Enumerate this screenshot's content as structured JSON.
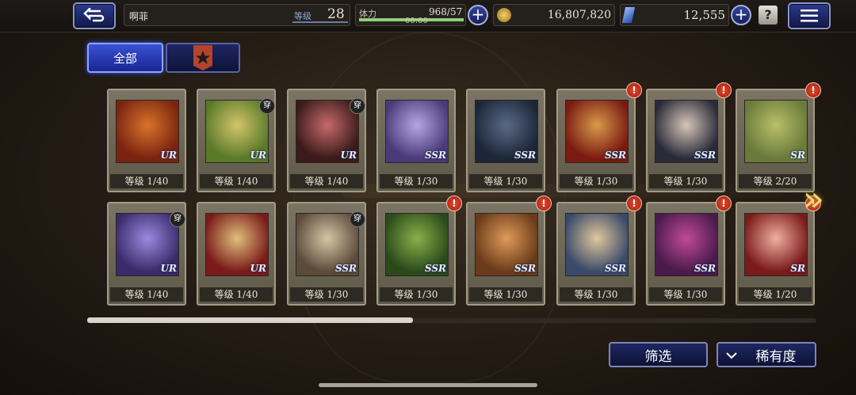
{
  "header": {
    "player_name": "啊菲",
    "level_label": "等级",
    "level_value": "28",
    "stamina_label": "体力",
    "stamina_value": "968/57",
    "stamina_timer": "00:00",
    "gold_value": "16,807,820",
    "gem_value": "12,555",
    "help_label": "?"
  },
  "tabs": {
    "all_label": "全部"
  },
  "cards": [
    {
      "level": "等级 1/40",
      "rarity": "UR",
      "badge": false,
      "alert": false,
      "colors": [
        "#7a2410",
        "#d9732a"
      ]
    },
    {
      "level": "等级 1/40",
      "rarity": "UR",
      "badge": true,
      "alert": false,
      "colors": [
        "#5a7a2a",
        "#d4c46a"
      ]
    },
    {
      "level": "等级 1/40",
      "rarity": "UR",
      "badge": true,
      "alert": false,
      "colors": [
        "#3a1a1a",
        "#c86a6a"
      ]
    },
    {
      "level": "等级 1/30",
      "rarity": "SSR",
      "badge": false,
      "alert": false,
      "colors": [
        "#4a3a7a",
        "#b6a6e0"
      ]
    },
    {
      "level": "等级 1/30",
      "rarity": "SSR",
      "badge": false,
      "alert": false,
      "colors": [
        "#1c2638",
        "#5a6a86"
      ]
    },
    {
      "level": "等级 1/30",
      "rarity": "SSR",
      "badge": false,
      "alert": true,
      "colors": [
        "#7a1a12",
        "#d89a4a"
      ]
    },
    {
      "level": "等级 1/30",
      "rarity": "SSR",
      "badge": false,
      "alert": true,
      "colors": [
        "#2a2a3a",
        "#d6c6b6"
      ]
    },
    {
      "level": "等级 2/20",
      "rarity": "SR",
      "badge": false,
      "alert": true,
      "colors": [
        "#6a7a3a",
        "#b8c06a"
      ]
    },
    {
      "level": "等级 1/40",
      "rarity": "UR",
      "badge": true,
      "alert": false,
      "colors": [
        "#3a2a6a",
        "#9a8ae0"
      ]
    },
    {
      "level": "等级 1/40",
      "rarity": "UR",
      "badge": false,
      "alert": false,
      "colors": [
        "#7a1a1a",
        "#e0c07a"
      ]
    },
    {
      "level": "等级 1/30",
      "rarity": "SSR",
      "badge": true,
      "alert": false,
      "colors": [
        "#5a4a3a",
        "#d6c6a6"
      ]
    },
    {
      "level": "等级 1/30",
      "rarity": "SSR",
      "badge": false,
      "alert": true,
      "colors": [
        "#2a4a1a",
        "#8ab04a"
      ]
    },
    {
      "level": "等级 1/30",
      "rarity": "SSR",
      "badge": false,
      "alert": true,
      "colors": [
        "#6a3a1a",
        "#e09a5a"
      ]
    },
    {
      "level": "等级 1/30",
      "rarity": "SSR",
      "badge": false,
      "alert": true,
      "colors": [
        "#3a4a6a",
        "#e0c89a"
      ]
    },
    {
      "level": "等级 1/30",
      "rarity": "SSR",
      "badge": false,
      "alert": true,
      "colors": [
        "#4a1a4a",
        "#c04a9a"
      ]
    },
    {
      "level": "等级 1/20",
      "rarity": "SR",
      "badge": false,
      "alert": true,
      "colors": [
        "#7a1a1a",
        "#f0b0a0"
      ]
    }
  ],
  "badge_text": "穿",
  "alert_text": "!",
  "bottom": {
    "filter_label": "筛选",
    "sort_label": "稀有度"
  },
  "colors": {
    "accent_blue": "#2b3a8c",
    "alert_red": "#c0301c",
    "arrow_gold": "#f2d57a"
  }
}
